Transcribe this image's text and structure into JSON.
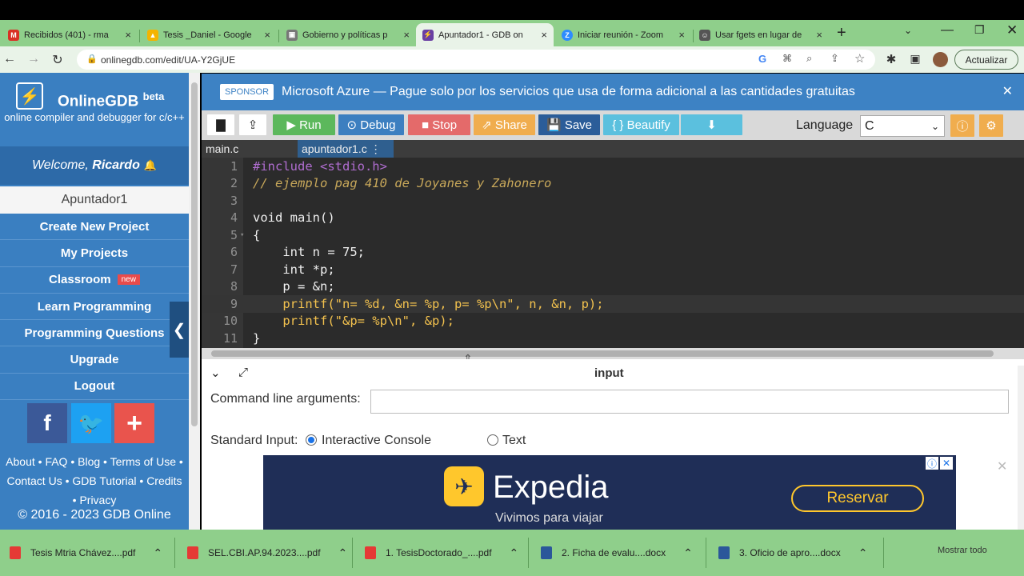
{
  "browser": {
    "tabs": [
      {
        "title": "Recibidos (401) - rma",
        "icon": "gmail-icon",
        "color": "#d93025",
        "glyph": "M"
      },
      {
        "title": "Tesis _Daniel - Google",
        "icon": "google-drive-icon",
        "color": "#f4b400",
        "glyph": "▲"
      },
      {
        "title": "Gobierno y políticas p",
        "icon": "document-icon",
        "color": "#777777",
        "glyph": "▣"
      },
      {
        "title": "Apuntador1 - GDB on",
        "icon": "gdb-icon",
        "color": "#6a3fa3",
        "glyph": "⚡"
      },
      {
        "title": "Iniciar reunión - Zoom",
        "icon": "zoom-icon",
        "color": "#2d8cff",
        "glyph": "Z"
      },
      {
        "title": "Usar fgets en lugar de",
        "icon": "person-icon",
        "color": "#555555",
        "glyph": "☺"
      }
    ],
    "url": "onlinegdb.com/edit/UA-Y2GjUE",
    "update_label": "Actualizar"
  },
  "sidebar": {
    "brand": "OnlineGDB",
    "brand_suffix": "beta",
    "subtitle": "online compiler and debugger for c/c++",
    "welcome_prefix": "Welcome, ",
    "user": "Ricardo",
    "project": "Apuntador1",
    "menu": [
      {
        "label": "Create New Project"
      },
      {
        "label": "My Projects"
      },
      {
        "label": "Classroom",
        "badge": "new"
      },
      {
        "label": "Learn Programming"
      },
      {
        "label": "Programming Questions"
      },
      {
        "label": "Upgrade"
      },
      {
        "label": "Logout"
      }
    ],
    "social": [
      {
        "glyph": "f",
        "color": "#3b5998",
        "name": "facebook-icon"
      },
      {
        "glyph": "🐦",
        "color": "#1da1f2",
        "name": "twitter-icon"
      },
      {
        "glyph": "+",
        "color": "#e9544d",
        "name": "plus-icon"
      }
    ],
    "footer_line1": "About • FAQ • Blog • Terms of Use •",
    "footer_line2": "Contact Us • GDB Tutorial • Credits",
    "footer_line3": "• Privacy",
    "copyright": "© 2016 - 2023 GDB Online"
  },
  "sponsor": {
    "tag": "SPONSOR",
    "text": "Microsoft Azure — Pague solo por los servicios que usa de forma adicional a las cantidades gratuitas"
  },
  "toolbar": {
    "run": "Run",
    "debug": "Debug",
    "stop": "Stop",
    "share": "Share",
    "save": "Save",
    "beautify": "{ } Beautify",
    "language_label": "Language",
    "language": "C"
  },
  "files": [
    "main.c",
    "apuntador1.c"
  ],
  "code_lines": [
    "#include <stdio.h>",
    "// ejemplo pag 410 de Joyanes y Zahonero",
    "",
    "void main()",
    "{",
    "    int n = 75;",
    "    int *p;",
    "    p = &n;",
    "    printf(\"n= %d, &n= %p, p= %p\\n\", n, &n, p);",
    "    printf(\"&p= %p\\n\", &p);",
    "}"
  ],
  "io": {
    "title": "input",
    "cmd_label": "Command line arguments:",
    "stdin_label": "Standard Input:",
    "option_console": "Interactive Console",
    "option_text": "Text"
  },
  "ad": {
    "brand": "Expedia",
    "tagline": "Vivimos para viajar",
    "cta": "Reservar"
  },
  "downloads": [
    {
      "name": "Tesis Mtria Chávez....pdf",
      "color": "#e53935"
    },
    {
      "name": "SEL.CBI.AP.94.2023....pdf",
      "color": "#e53935"
    },
    {
      "name": "1. TesisDoctorado_....pdf",
      "color": "#e53935"
    },
    {
      "name": "2. Ficha de evalu....docx",
      "color": "#2b579a"
    },
    {
      "name": "3. Oficio de apro....docx",
      "color": "#2b579a"
    }
  ],
  "corner_text": "Mostrar todo"
}
